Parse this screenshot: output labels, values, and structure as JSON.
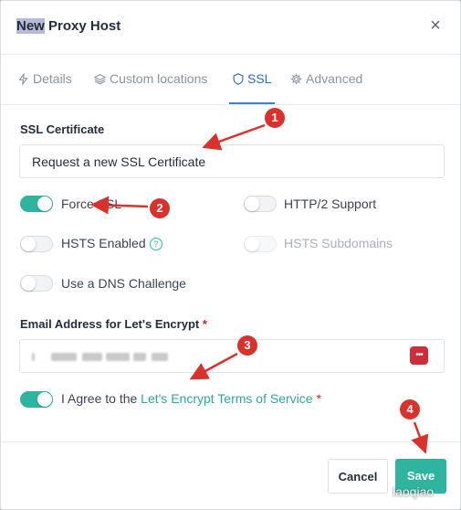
{
  "header": {
    "title_highlight": "New",
    "title_rest": " Proxy Host"
  },
  "tabs": [
    {
      "label": "Details",
      "icon": "bolt-icon"
    },
    {
      "label": "Custom locations",
      "icon": "layers-icon"
    },
    {
      "label": "SSL",
      "icon": "shield-icon",
      "active": true
    },
    {
      "label": "Advanced",
      "icon": "gear-icon"
    }
  ],
  "ssl": {
    "certificate_label": "SSL Certificate",
    "certificate_value": "Request a new SSL Certificate",
    "toggles": [
      {
        "label": "Force SSL",
        "on": true,
        "disabled": false
      },
      {
        "label": "HTTP/2 Support",
        "on": false,
        "disabled": false
      },
      {
        "label": "HSTS Enabled",
        "on": false,
        "disabled": false
      },
      {
        "label": "HSTS Subdomains",
        "on": false,
        "disabled": true
      },
      {
        "label": "Use a DNS Challenge",
        "on": false,
        "disabled": false
      }
    ],
    "hsts_help": "?",
    "email_label": "Email Address for Let's Encrypt",
    "required_mark": "*",
    "password_icon_text": "•••",
    "agree_prefix": "I Agree to the ",
    "agree_link": "Let's Encrypt Terms of Service"
  },
  "footer": {
    "cancel_label": "Cancel",
    "save_label": "Save"
  },
  "annotations": [
    "1",
    "2",
    "3",
    "4"
  ],
  "watermark": "laoqiao",
  "colors": {
    "accent": "#2fb59f",
    "active_tab": "#2d6bb4",
    "annotation": "#d7322c"
  }
}
